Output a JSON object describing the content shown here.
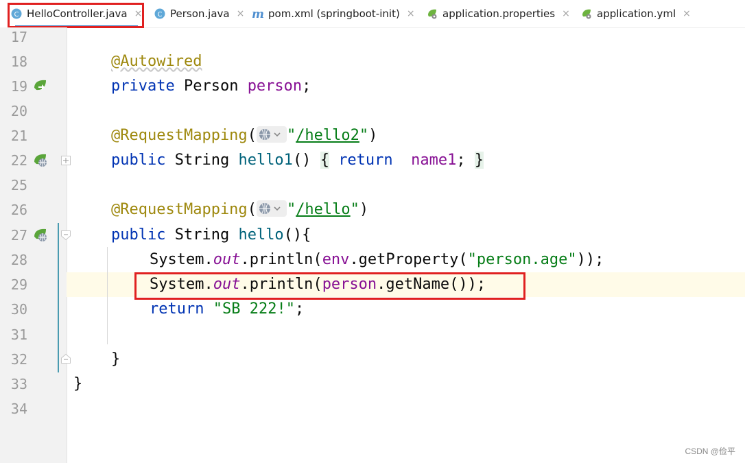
{
  "tabs": [
    {
      "label": "HelloController.java",
      "icon": "java-class-icon",
      "active": true
    },
    {
      "label": "Person.java",
      "icon": "java-class-icon",
      "active": false
    },
    {
      "label": "pom.xml (springboot-init)",
      "icon": "maven-icon",
      "active": false
    },
    {
      "label": "application.properties",
      "icon": "spring-config-icon",
      "active": false
    },
    {
      "label": "application.yml",
      "icon": "spring-config-icon",
      "active": false
    }
  ],
  "tab_close_glyph": "×",
  "line_numbers": [
    "17",
    "18",
    "19",
    "20",
    "21",
    "22",
    "25",
    "26",
    "27",
    "28",
    "29",
    "30",
    "31",
    "32",
    "33",
    "34"
  ],
  "code": {
    "l18_annotation": "@Autowired",
    "l19_private": "private",
    "l19_type": " Person ",
    "l19_field": "person",
    "l19_semi": ";",
    "l21_annotation": "@RequestMapping",
    "l21_open": "(",
    "l21_q1": "\"",
    "l21_path": "/hello2",
    "l21_q2": "\"",
    "l21_close": ")",
    "l22_public": "public",
    "l22_type": " String ",
    "l22_method": "hello1",
    "l22_parens": "()",
    "l22_brace_open": "{",
    "l22_return": "return",
    "l22_field": "name1",
    "l22_semi": ";",
    "l22_brace_close": "}",
    "l26_annotation": "@RequestMapping",
    "l26_open": "(",
    "l26_q1": "\"",
    "l26_path": "/hello",
    "l26_q2": "\"",
    "l26_close": ")",
    "l27_public": "public",
    "l27_type": " String ",
    "l27_method": "hello",
    "l27_rest": "(){",
    "l28_a": "System.",
    "l28_out": "out",
    "l28_b": ".println(",
    "l28_env": "env",
    "l28_c": ".getProperty(",
    "l28_str": "\"person.age\"",
    "l28_d": "));",
    "l29_a": "System.",
    "l29_out": "out",
    "l29_b": ".println(",
    "l29_person": "person",
    "l29_c": ".getName());",
    "l30_return": "return",
    "l30_str": "\"SB 222!\"",
    "l30_semi": ";",
    "l32_brace": "}",
    "l33_brace": "}"
  },
  "watermark": "CSDN @俭平",
  "colors": {
    "highlight_box": "#e02020",
    "annotation": "#9e880d",
    "keyword": "#0033b3",
    "field": "#871094",
    "string": "#067d17"
  }
}
